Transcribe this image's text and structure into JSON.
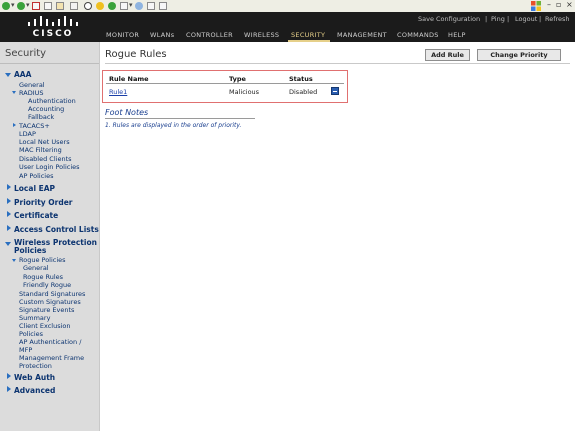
{
  "header": {
    "logo_text": "CISCO",
    "utility_links": [
      "Save Configuration",
      "Ping",
      "Logout",
      "Refresh"
    ],
    "menu": [
      "MONITOR",
      "WLANs",
      "CONTROLLER",
      "WIRELESS",
      "SECURITY",
      "MANAGEMENT",
      "COMMANDS",
      "HELP"
    ],
    "active_menu": "SECURITY"
  },
  "sidebar": {
    "title": "Security",
    "aaa": {
      "label": "AAA",
      "general": "General",
      "radius": "RADIUS",
      "radius_items": [
        "Authentication",
        "Accounting",
        "Fallback"
      ],
      "tacacs": "TACACS+",
      "items": [
        "LDAP",
        "Local Net Users",
        "MAC Filtering",
        "Disabled Clients",
        "User Login Policies",
        "AP Policies"
      ]
    },
    "sections_a": [
      "Local EAP",
      "Priority Order",
      "Certificate",
      "Access Control Lists"
    ],
    "wpp": {
      "label_line1": "Wireless Protection",
      "label_line2": "Policies",
      "rogue_policies": "Rogue Policies",
      "rogue_items": [
        "General",
        "Rogue Rules",
        "Friendly Rogue"
      ],
      "items": [
        "Standard Signatures",
        "Custom Signatures",
        "Signature Events",
        "Summary",
        "Client Exclusion",
        "Policies",
        "AP Authentication /",
        "MFP",
        "Management Frame",
        "Protection"
      ]
    },
    "sections_b": [
      "Web Auth",
      "Advanced"
    ]
  },
  "main": {
    "title": "Rogue Rules",
    "buttons": {
      "add_rule": "Add Rule",
      "change_priority": "Change Priority"
    },
    "table": {
      "headers": [
        "Rule Name",
        "Type",
        "Status"
      ],
      "rows": [
        {
          "name": "Rule1",
          "type": "Malicious",
          "status": "Disabled"
        }
      ]
    },
    "footnotes": {
      "title": "Foot Notes",
      "text": "1. Rules are displayed in the order of priority."
    }
  }
}
